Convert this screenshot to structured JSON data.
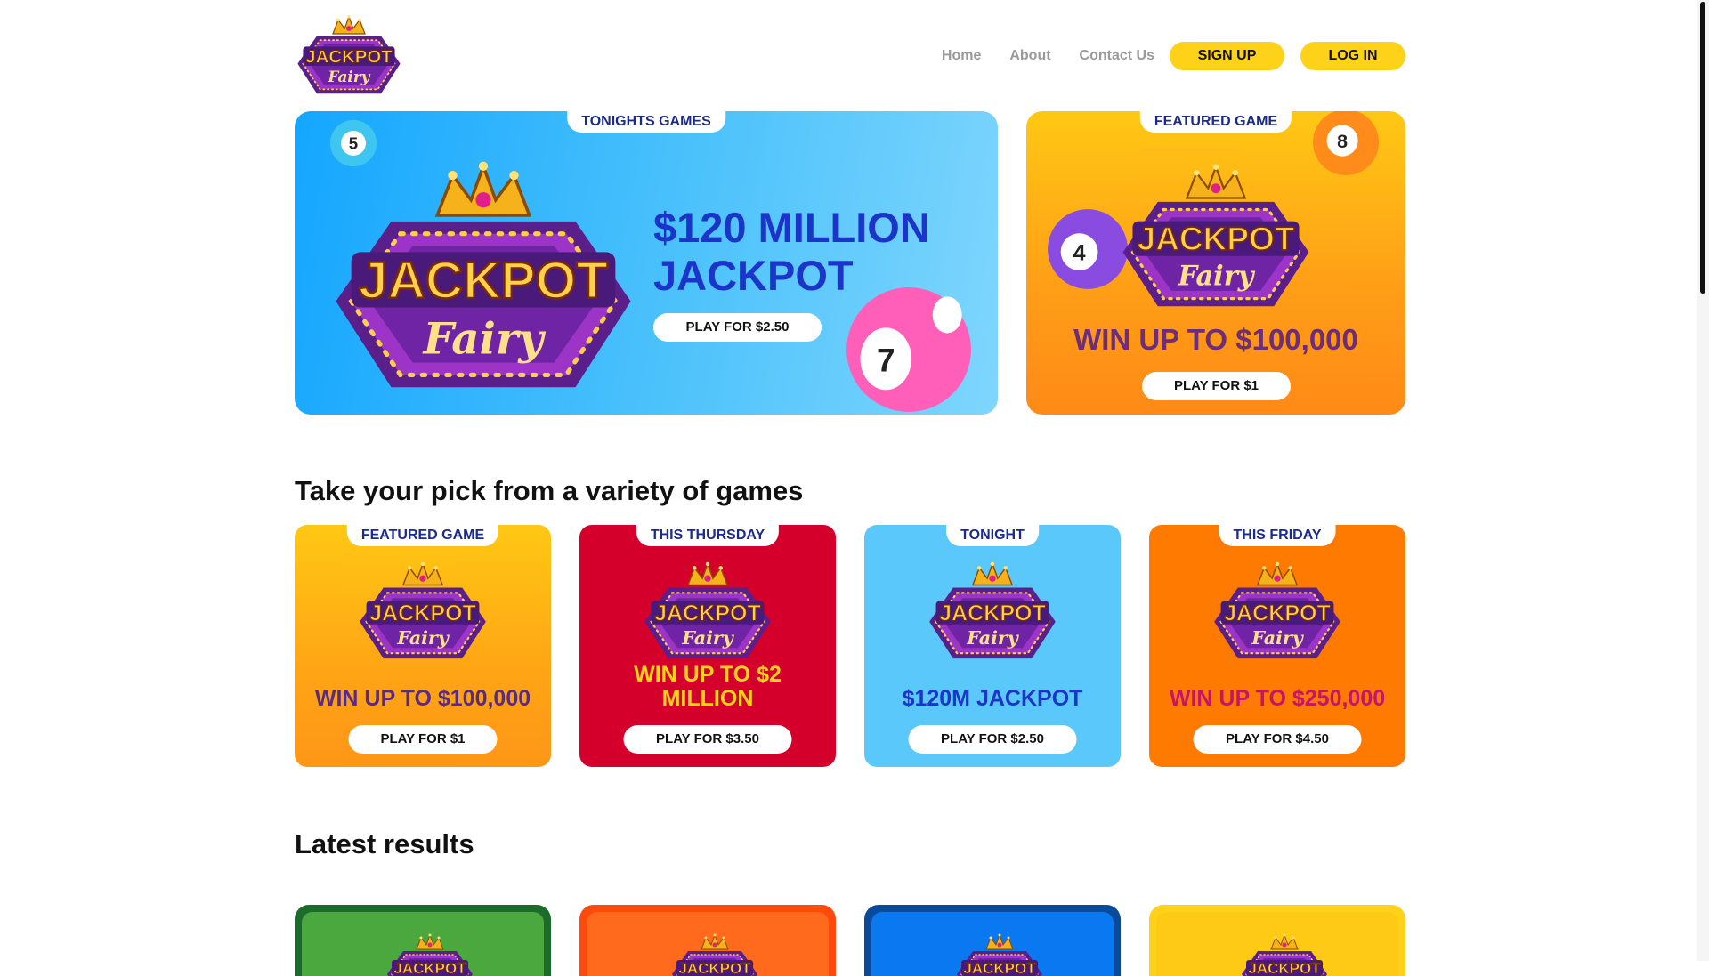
{
  "brand": {
    "logo_text": "JACKPOT",
    "logo_script": "Fairy"
  },
  "nav": {
    "links": [
      "Home",
      "About",
      "Contact Us"
    ],
    "signup": "SIGN UP",
    "login": "LOG IN"
  },
  "hero": {
    "main": {
      "tag": "TONIGHTS GAMES",
      "headline_line1": "$120 MILLION",
      "headline_line2": "JACKPOT",
      "play": "PLAY FOR $2.50",
      "balls": [
        "5",
        "7"
      ]
    },
    "featured": {
      "tag": "FEATURED GAME",
      "win": "WIN UP TO $100,000",
      "play": "PLAY FOR $1",
      "balls": [
        "8",
        "4"
      ]
    }
  },
  "games": {
    "heading": "Take your pick from a variety of games",
    "cards": [
      {
        "tag": "FEATURED GAME",
        "win": "WIN UP TO $100,000",
        "play": "PLAY FOR $1"
      },
      {
        "tag": "THIS THURSDAY",
        "win": "WIN UP TO $2 MILLION",
        "play": "PLAY FOR $3.50"
      },
      {
        "tag": "TONIGHT",
        "win": "$120M JACKPOT",
        "play": "PLAY FOR $2.50"
      },
      {
        "tag": "THIS FRIDAY",
        "win": "WIN UP TO $250,000",
        "play": "PLAY FOR $4.50"
      }
    ]
  },
  "results": {
    "heading": "Latest results"
  },
  "colors": {
    "accent_yellow": "#ffd21a",
    "hero_blue": "#14a6ff",
    "headline_blue": "#1c35c9",
    "card_red": "#d4002b",
    "card_orange": "#ff7a00",
    "card_sky": "#5ac8fb"
  }
}
